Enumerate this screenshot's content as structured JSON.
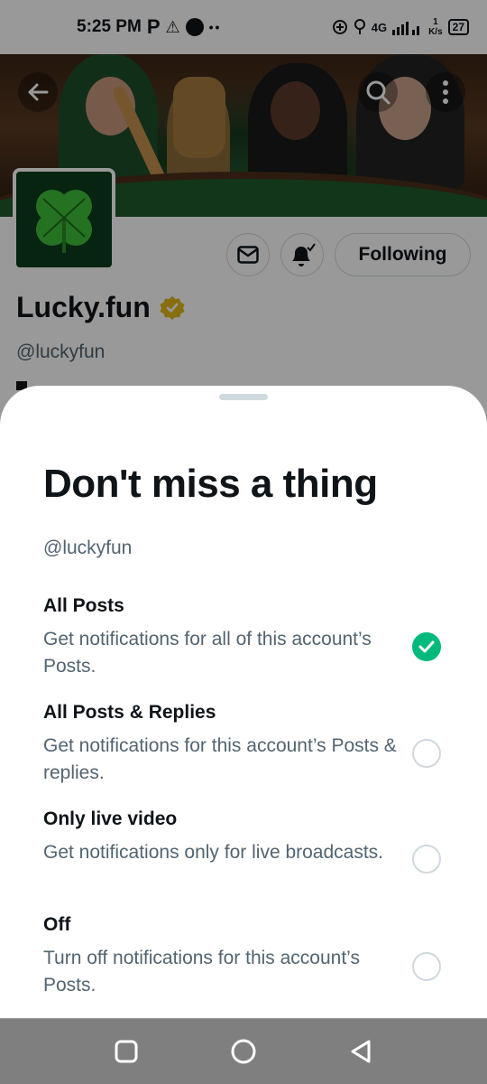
{
  "status_bar": {
    "time": "5:25 PM",
    "p_icon": "P",
    "warning_icon": "⚠",
    "dots": "••",
    "network_speed_value": "1",
    "network_speed_unit": "K/s",
    "signal_label": "4G",
    "battery": "27"
  },
  "profile": {
    "name": "Lucky.fun",
    "handle": "@luckyfun",
    "following_label": "Following",
    "verified_color": "#e2b719"
  },
  "sheet": {
    "title": "Don't miss a thing",
    "handle": "@luckyfun",
    "options": [
      {
        "title": "All Posts",
        "description": "Get notifications for all of this account’s Posts.",
        "selected": true
      },
      {
        "title": "All Posts & Replies",
        "description": "Get notifications for this account’s Posts & replies.",
        "selected": false
      },
      {
        "title": "Only live video",
        "description": "Get notifications only for live broadcasts.",
        "selected": false
      },
      {
        "title": "Off",
        "description": "Turn off notifications for this account’s Posts.",
        "selected": false
      }
    ],
    "selected_color": "#00ba7c"
  },
  "icons": {
    "back": "arrow-left-icon",
    "search": "search-icon",
    "more": "more-vertical-icon",
    "message": "envelope-icon",
    "bell": "bell-check-icon",
    "avatar": "four-leaf-clover-icon",
    "nav_recent": "square-icon",
    "nav_home": "circle-icon",
    "nav_back": "triangle-back-icon"
  }
}
